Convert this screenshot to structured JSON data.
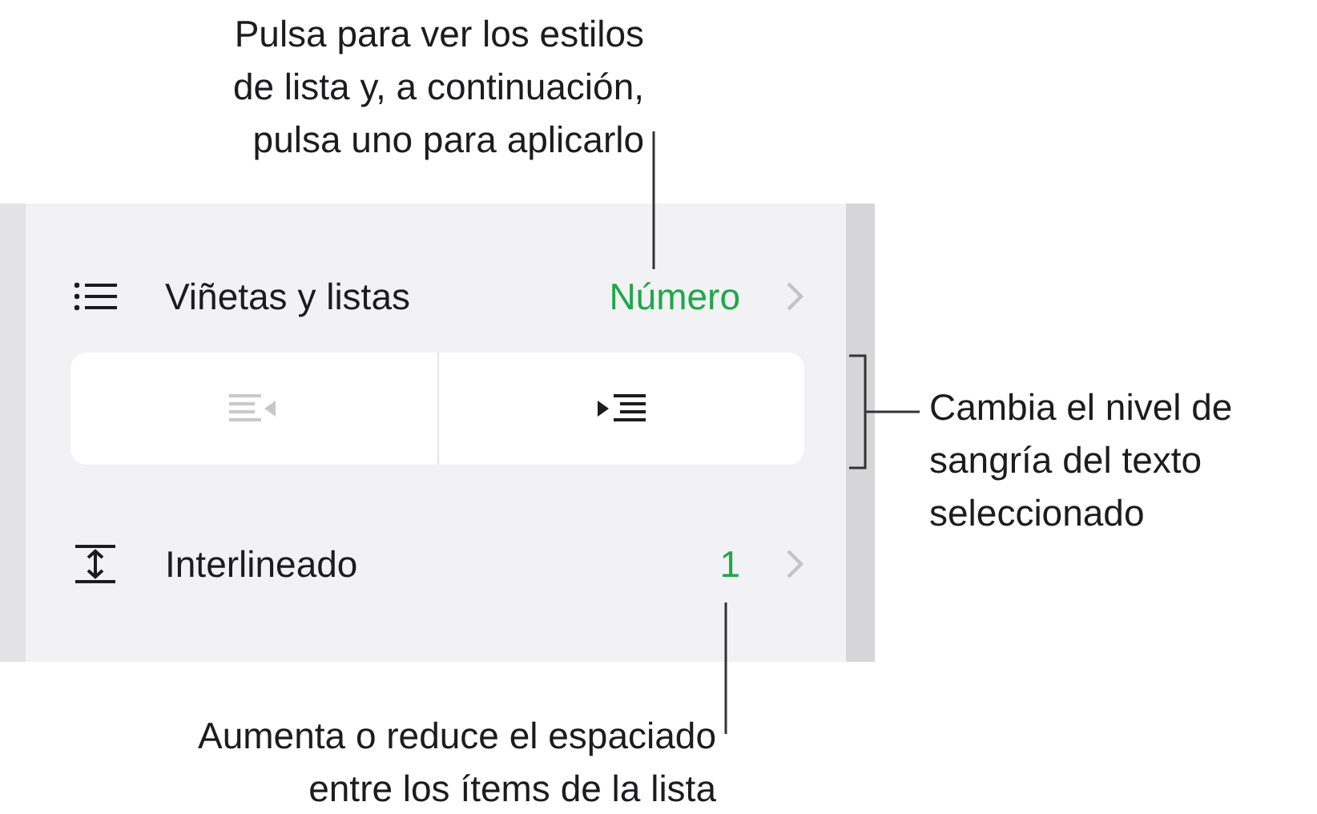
{
  "panel": {
    "rows": [
      {
        "kind": "menu",
        "label": "Viñetas y listas",
        "value": "Número"
      },
      {
        "kind": "segmented",
        "buttons": [
          {
            "kind": "outdent",
            "disabled": true
          },
          {
            "kind": "indent",
            "disabled": false
          }
        ]
      },
      {
        "kind": "menu",
        "label": "Interlineado",
        "value": "1"
      }
    ]
  },
  "callouts": [
    {
      "lines": [
        "Pulsa para ver los estilos",
        "de lista y, a continuación,",
        "pulsa uno para aplicarlo"
      ]
    },
    {
      "lines": [
        "Cambia el nivel de",
        "sangría del texto",
        "seleccionado"
      ]
    },
    {
      "lines": [
        "Aumenta o reduce el espaciado",
        "entre los ítems de la lista"
      ]
    }
  ]
}
